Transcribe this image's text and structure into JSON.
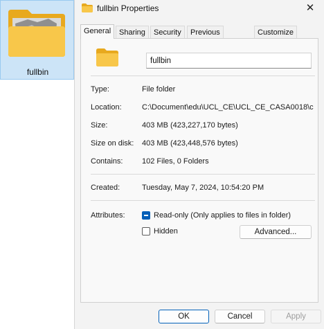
{
  "desktop": {
    "folder_label": "fullbin"
  },
  "window": {
    "title": "fullbin Properties",
    "close_glyph": "✕"
  },
  "tabs": [
    "General",
    "Sharing",
    "Security",
    "Previous Versions",
    "Customize"
  ],
  "general": {
    "name_value": "fullbin",
    "rows": [
      {
        "label": "Type:",
        "value": "File folder"
      },
      {
        "label": "Location:",
        "value": "C:\\Document\\edu\\UCL_CE\\UCL_CE_CASA0018\\c"
      },
      {
        "label": "Size:",
        "value": "403 MB (423,227,170 bytes)"
      },
      {
        "label": "Size on disk:",
        "value": "403 MB (423,448,576 bytes)"
      },
      {
        "label": "Contains:",
        "value": "102 Files, 0 Folders"
      }
    ],
    "created_label": "Created:",
    "created_value": "Tuesday, May 7, 2024, 10:54:20 PM",
    "attributes_label": "Attributes:",
    "readonly_label": "Read-only (Only applies to files in folder)",
    "hidden_label": "Hidden",
    "advanced_label": "Advanced..."
  },
  "footer": {
    "ok": "OK",
    "cancel": "Cancel",
    "apply": "Apply"
  },
  "icons": [
    "folder-icon",
    "close-icon"
  ],
  "colors": {
    "accent": "#005fb8",
    "selection": "#cce4f7",
    "folder": "#f8c74a"
  }
}
